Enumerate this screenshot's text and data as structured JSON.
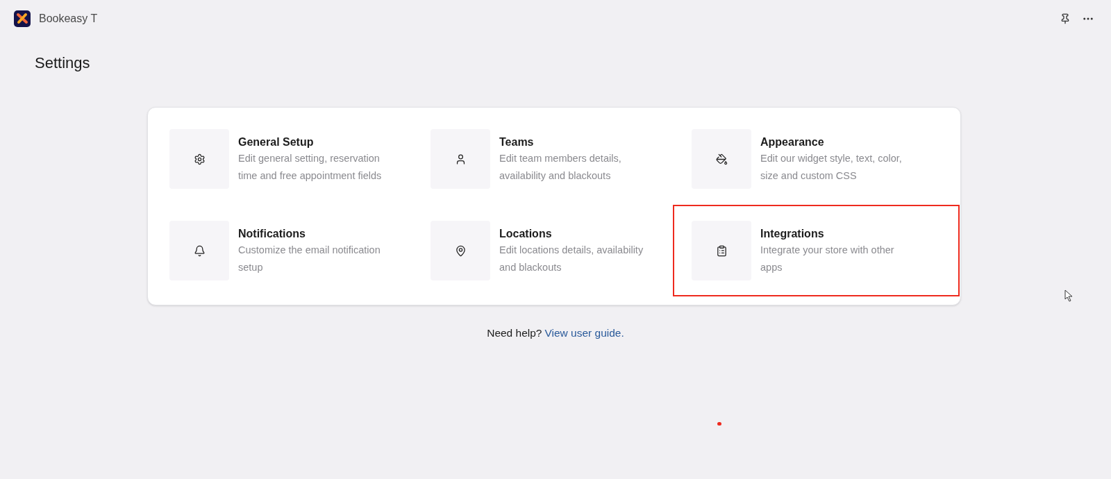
{
  "app": {
    "name": "Bookeasy T"
  },
  "page": {
    "title": "Settings"
  },
  "items": [
    {
      "title": "General Setup",
      "description": "Edit general setting, reservation time and free appointment fields",
      "highlighted": false
    },
    {
      "title": "Teams",
      "description": "Edit team members details, availability and blackouts",
      "highlighted": false
    },
    {
      "title": "Appearance",
      "description": "Edit our widget style, text, color, size and custom CSS",
      "highlighted": false
    },
    {
      "title": "Notifications",
      "description": "Customize the email notification setup",
      "highlighted": false
    },
    {
      "title": "Locations",
      "description": "Edit locations details, availability and blackouts",
      "highlighted": false
    },
    {
      "title": "Integrations",
      "description": "Integrate your store with other apps",
      "highlighted": true
    }
  ],
  "help": {
    "text": "Need help?",
    "link": "View user guide."
  }
}
